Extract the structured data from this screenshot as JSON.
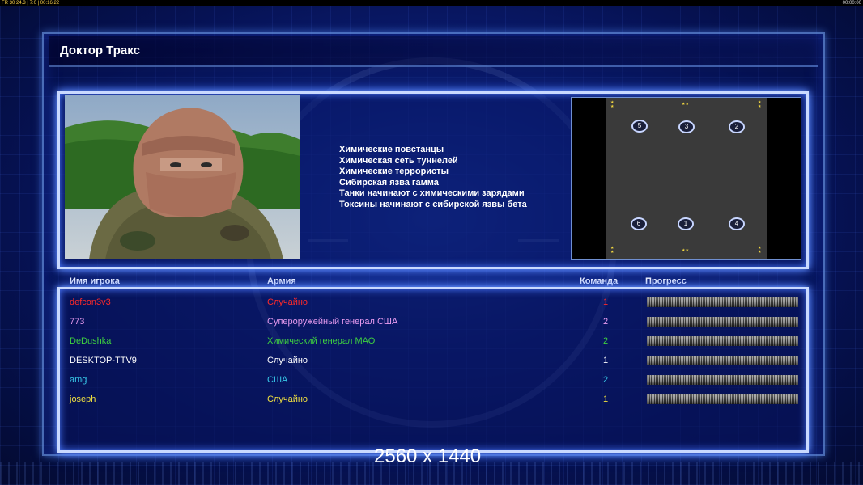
{
  "topbar": {
    "left": "FR 30 24.3 | 7:0 | 00:16:22",
    "right": "00:00:00"
  },
  "title": "Доктор Тракс",
  "rules": [
    "Химические повстанцы",
    "Химическая сеть туннелей",
    "Химические террористы",
    "Сибирская язва гамма",
    "Танки начинают с химическими зарядами",
    "Токсины начинают с сибирской язвы бета"
  ],
  "map": {
    "spawns": [
      {
        "label": "5"
      },
      {
        "label": "3"
      },
      {
        "label": "2"
      },
      {
        "label": "6"
      },
      {
        "label": "1"
      },
      {
        "label": "4"
      }
    ]
  },
  "headers": {
    "player": "Имя игрока",
    "army": "Армия",
    "team": "Команда",
    "progress": "Прогресс"
  },
  "players": [
    {
      "name": "defcon3v3",
      "army": "Случайно",
      "team": "1",
      "color": "#ff2a2a",
      "progress": 1.0
    },
    {
      "name": "773",
      "army": "Супероружейный генерал США",
      "team": "2",
      "color": "#e89cf0",
      "progress": 1.0
    },
    {
      "name": "DeDushka",
      "army": "Химический генерал МАО",
      "team": "2",
      "color": "#3fd23f",
      "progress": 1.0
    },
    {
      "name": "DESKTOP-TTV9",
      "army": "Случайно",
      "team": "1",
      "color": "#ffffff",
      "progress": 1.0
    },
    {
      "name": "amg",
      "army": "США",
      "team": "2",
      "color": "#38c8e8",
      "progress": 1.0
    },
    {
      "name": "joseph",
      "army": "Случайно",
      "team": "1",
      "color": "#f0e040",
      "progress": 1.0
    }
  ],
  "resolution_label": "2560 x 1440"
}
